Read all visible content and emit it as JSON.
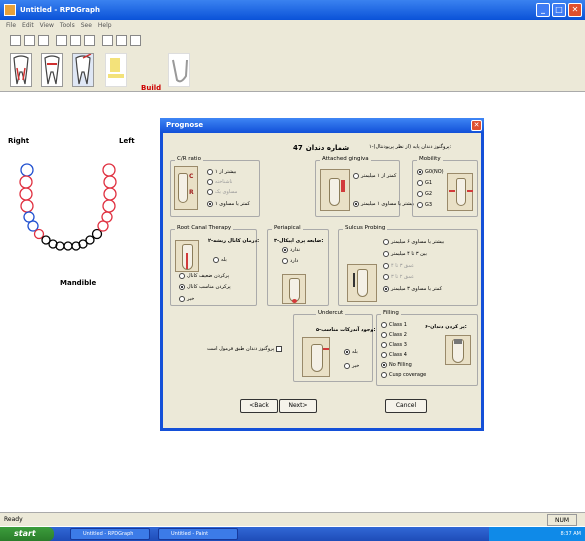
{
  "window": {
    "title": "Untitled - RPDGraph"
  },
  "menu": [
    "File",
    "Edit",
    "View",
    "Tools",
    "See",
    "Help"
  ],
  "ribbon": {
    "build_label": "Build"
  },
  "canvas": {
    "right_label": "Right",
    "left_label": "Left",
    "arch_label": "Mandible"
  },
  "dialog": {
    "title": "Prognose",
    "tooth_label": "شماره دندان",
    "tooth_number": "47",
    "question": "۱-پروگنوز دندان پایه (از نظر پریودنتال):",
    "cr": {
      "title": "C/R ratio",
      "options": [
        "بیشتر از ۱",
        "ناشناخته",
        "مساوی یک",
        "کمتر یا مساوی ۱"
      ],
      "selected": 3,
      "icon_letters": [
        "C",
        "R"
      ]
    },
    "gingiva": {
      "title": "Attached gingiva",
      "options": [
        "کمتر از ۱ میلیمتر",
        "بیشتر یا مساوی ۱ میلیمتر"
      ],
      "selected": 1
    },
    "mobility": {
      "title": "Mobility",
      "options": [
        "G0(NO)",
        "G1",
        "G2",
        "G3"
      ],
      "selected": 0
    },
    "rct": {
      "title": "Root Canal Therapy",
      "question": "۲-درمان کانال ریشه:",
      "options": [
        "بله",
        "پرکردن ضعیف کانال",
        "پرکردن مناسب کانال",
        "خیر"
      ],
      "selected": 2
    },
    "periapical": {
      "title": "Periapical",
      "question": "۳-ضایعه پری اپیکال:",
      "options": [
        "ندارد",
        "دارد"
      ],
      "selected": 0
    },
    "sulcus": {
      "title": "Sulcus Probing",
      "options": [
        "بیشتر یا مساوی ۶ میلیمتر",
        "بین ۳ تا ۴ میلیمتر",
        "عمق ۳ تا ۴",
        "عمق ۲ تا ۳",
        "کمتر یا مساوی ۳ میلیمتر"
      ],
      "selected": 4
    },
    "undercut": {
      "title": "Undercut",
      "question": "۵-وجود آندرکات مناسب:",
      "options": [
        "بله",
        "خیر"
      ],
      "selected": 0,
      "check_label": "پروگنوز دندان طبق فرمول است"
    },
    "filling": {
      "title": "Filling",
      "question": "۶-پر کردن دندان:",
      "options": [
        "Class 1",
        "Class 2",
        "Class 3",
        "Class 4",
        "No Filling",
        "Cusp coverage"
      ],
      "selected": 4
    },
    "buttons": {
      "back": "<Back",
      "next": "Next>",
      "cancel": "Cancel"
    }
  },
  "status": {
    "text": "Ready",
    "num": "NUM"
  },
  "taskbar": {
    "start": "start",
    "items": [
      "Untitled - RPDGraph",
      "Untitled - Paint"
    ],
    "clock": "8:37 AM"
  },
  "colors": {
    "titlebar": "#0a52d8",
    "dialog_face": "#ece9d8",
    "tooth_red": "#e03040",
    "tooth_blue": "#2050d0"
  }
}
